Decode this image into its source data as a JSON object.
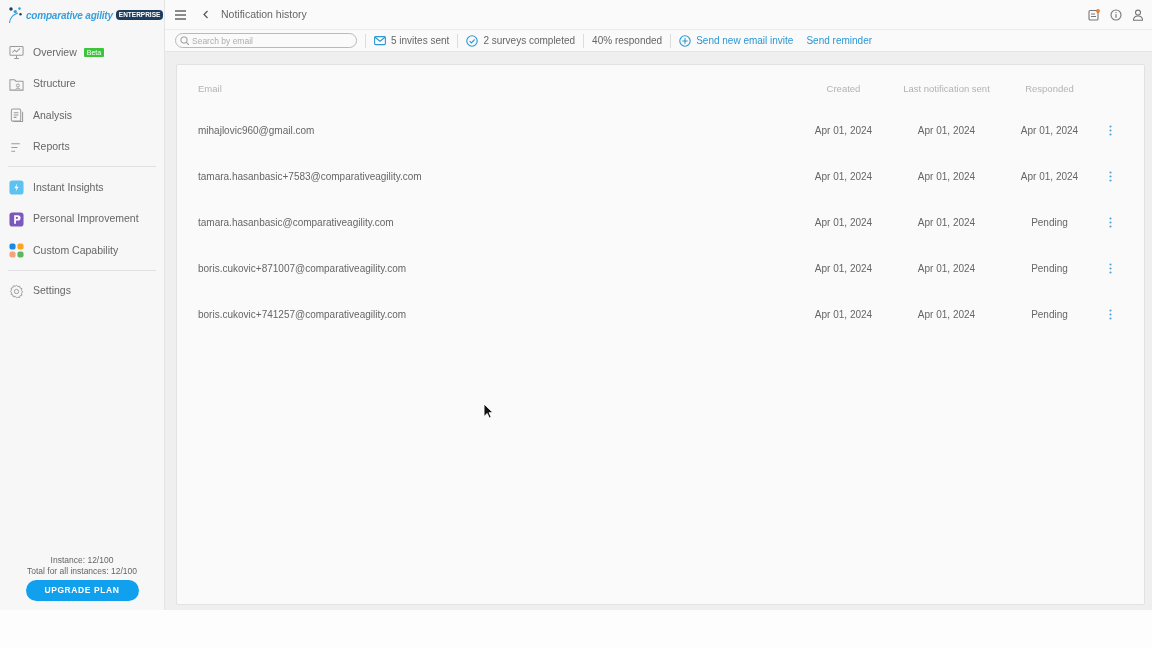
{
  "sidebar": {
    "logo": {
      "name": "comparative agility",
      "badge": "ENTERPRISE"
    },
    "groups": [
      {
        "items": [
          {
            "label": "Overview",
            "badge": "Beta"
          },
          {
            "label": "Structure"
          },
          {
            "label": "Analysis"
          },
          {
            "label": "Reports"
          }
        ]
      },
      {
        "items": [
          {
            "label": "Instant Insights"
          },
          {
            "label": "Personal Improvement"
          },
          {
            "label": "Custom Capability"
          }
        ]
      },
      {
        "items": [
          {
            "label": "Settings"
          }
        ]
      }
    ],
    "usage": [
      "Instance: 12/100",
      "Total for all instances: 12/100"
    ],
    "upgrade_button": "UPGRADE PLAN"
  },
  "header": {
    "title": "Notification history"
  },
  "toolbar": {
    "search": {
      "placeholder": "Search by email"
    },
    "stats": [
      "5 invites sent",
      "2 surveys completed",
      "40% responded"
    ],
    "actions": [
      "Send new email invite",
      "Send reminder"
    ]
  },
  "table": {
    "columns": [
      "Email",
      "Created",
      "Last notification sent",
      "Responded"
    ],
    "rows": [
      {
        "email": "mihajlovic960@gmail.com",
        "created": "Apr 01, 2024",
        "last_notification_sent": "Apr 01, 2024",
        "responded": "Apr 01, 2024"
      },
      {
        "email": "tamara.hasanbasic+7583@comparativeagility.com",
        "created": "Apr 01, 2024",
        "last_notification_sent": "Apr 01, 2024",
        "responded": "Apr 01, 2024"
      },
      {
        "email": "tamara.hasanbasic@comparativeagility.com",
        "created": "Apr 01, 2024",
        "last_notification_sent": "Apr 01, 2024",
        "responded": "Pending"
      },
      {
        "email": "boris.cukovic+871007@comparativeagility.com",
        "created": "Apr 01, 2024",
        "last_notification_sent": "Apr 01, 2024",
        "responded": "Pending"
      },
      {
        "email": "boris.cukovic+741257@comparativeagility.com",
        "created": "Apr 01, 2024",
        "last_notification_sent": "Apr 01, 2024",
        "responded": "Pending"
      }
    ]
  }
}
